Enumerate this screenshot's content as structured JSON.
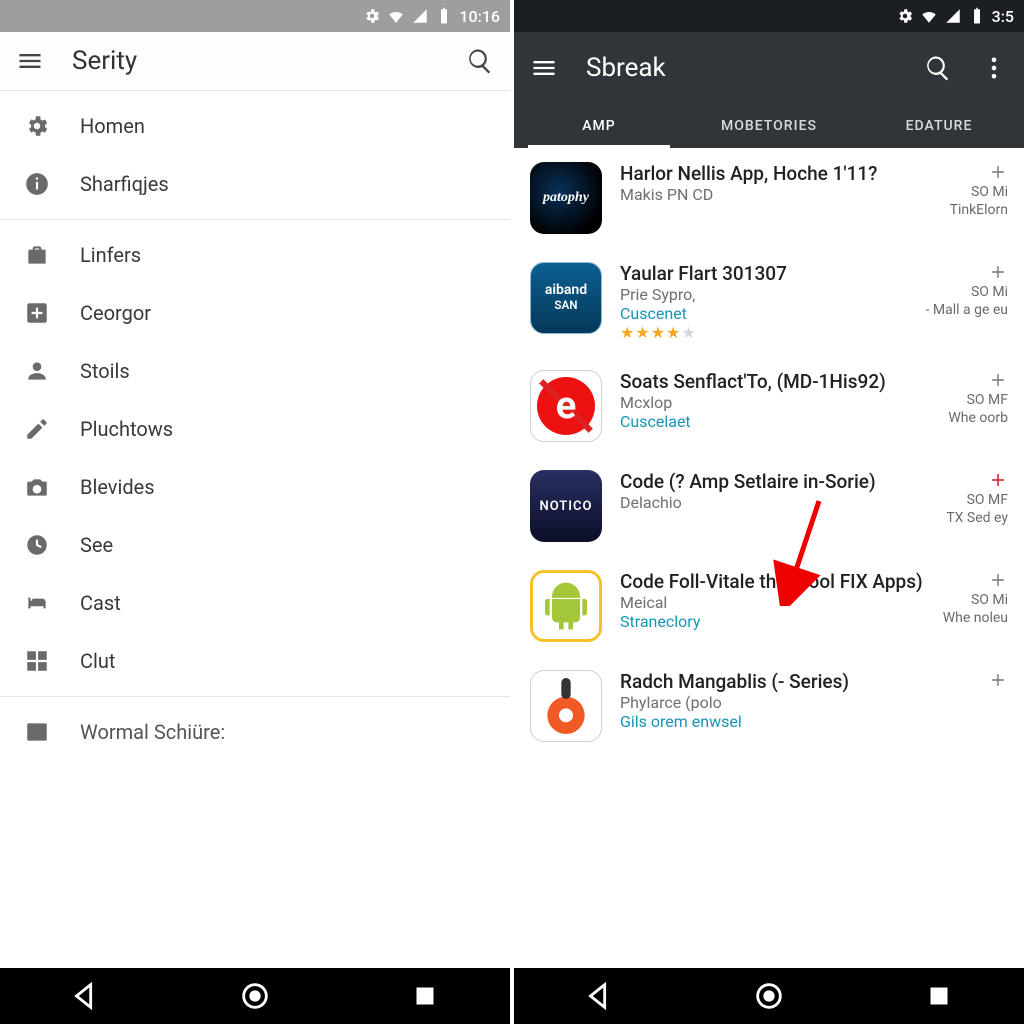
{
  "left": {
    "status": {
      "time": "10:16"
    },
    "appbar": {
      "title": "Serity"
    },
    "sections": [
      {
        "items": [
          {
            "icon": "gear-icon",
            "label": "Homen"
          },
          {
            "icon": "info-icon",
            "label": "Sharfiqjes"
          }
        ]
      },
      {
        "items": [
          {
            "icon": "briefcase-icon",
            "label": "Linfers"
          },
          {
            "icon": "plus-box-icon",
            "label": "Ceorgor"
          },
          {
            "icon": "person-icon",
            "label": "Stoils"
          },
          {
            "icon": "pencil-icon",
            "label": "Pluchtows"
          },
          {
            "icon": "camera-icon",
            "label": "Blevides"
          },
          {
            "icon": "clock-icon",
            "label": "See"
          },
          {
            "icon": "bed-icon",
            "label": "Cast"
          },
          {
            "icon": "grid-icon",
            "label": "Clut"
          }
        ]
      },
      {
        "items": [
          {
            "icon": "mail-icon",
            "label": "Wormal Schiüre:"
          }
        ]
      }
    ]
  },
  "right": {
    "status": {
      "time": "3:5"
    },
    "appbar": {
      "title": "Sbreak"
    },
    "tabs": [
      {
        "label": "AMP",
        "active": true
      },
      {
        "label": "MOBETORIES",
        "active": false
      },
      {
        "label": "EDATURE",
        "active": false
      }
    ],
    "apps": [
      {
        "icon": "patophy",
        "iconText": "patophy",
        "title": "Harlor Nellis App, Hoche 1'11?",
        "sub": "Makis PN CD",
        "tag": "",
        "so": "SO Mi",
        "note": "TinkElorn"
      },
      {
        "icon": "aiband",
        "iconText": "aiband",
        "title": "Yaular Flart 301307",
        "sub": "Prie Sypro,",
        "tag": "Cuscenet",
        "stars": 4,
        "so": "SO Mi",
        "note": "- Mall a ge eu"
      },
      {
        "icon": "e",
        "iconText": "",
        "title": "Soats Senflact'To, (MD-1His92)",
        "sub": "Mcxlop",
        "tag": "Cuscelaet",
        "so": "SO MF",
        "note": "Whe oorb"
      },
      {
        "icon": "notico",
        "iconText": "NOTICO",
        "title": "Code (? Amp Setlaire in-Sorie)",
        "sub": "Delachio",
        "tag": "",
        "so": "SO MF",
        "note": "TX Sed ey"
      },
      {
        "icon": "android",
        "iconText": "",
        "title": "Code Foll-Vitale the (1ool FIX Apps)",
        "sub": "Meical",
        "tag": "Straneclory",
        "so": "SO Mi",
        "note": "Whe noleu",
        "arrow": true
      },
      {
        "icon": "last",
        "iconText": "",
        "title": "Radch Mangablis (- Series)",
        "sub": "Phylarce (polo",
        "tag": "Gils orem enwsel",
        "so": "",
        "note": ""
      }
    ]
  }
}
